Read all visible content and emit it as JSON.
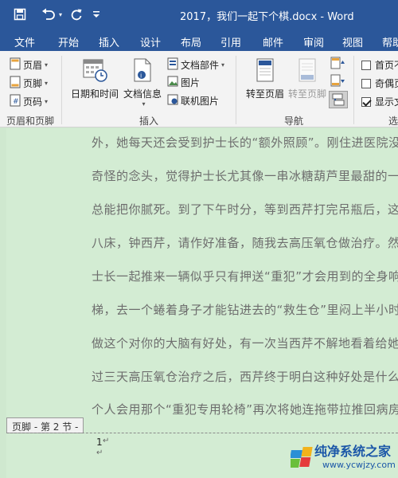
{
  "window": {
    "title": "2017，我们一起下个棋.docx - Word"
  },
  "quick_access": {
    "save_icon": "save-icon",
    "undo_icon": "undo-icon",
    "redo_icon": "redo-icon",
    "customize_icon": "customize-qat-icon"
  },
  "tabs": [
    {
      "label": "文件"
    },
    {
      "label": "开始"
    },
    {
      "label": "插入"
    },
    {
      "label": "设计"
    },
    {
      "label": "布局"
    },
    {
      "label": "引用"
    },
    {
      "label": "邮件"
    },
    {
      "label": "审阅"
    },
    {
      "label": "视图"
    },
    {
      "label": "帮助"
    }
  ],
  "ribbon": {
    "header_footer": {
      "header": "页眉",
      "footer": "页脚",
      "page_number": "页码",
      "group": "页眉和页脚"
    },
    "insert": {
      "date_time": "日期和时间",
      "doc_info": "文档信息",
      "doc_parts": "文档部件",
      "picture": "图片",
      "online_picture": "联机图片",
      "group": "插入"
    },
    "navigation": {
      "goto_header": "转至页眉",
      "goto_footer": "转至页脚",
      "group": "导航"
    },
    "options": {
      "first_page": "首页不",
      "odd_even": "奇偶页",
      "show_doc": "显示文",
      "group": "选"
    }
  },
  "document": {
    "lines": [
      "外，她每天还会受到护士长的“额外照顾”。刚住进医院没几",
      "奇怪的念头，觉得护士长尤其像一串冰糖葫芦里最甜的一颗",
      "总能把你腻死。到了下午时分，等到西芹打完吊瓶后，这颗糖",
      "八床，钟西芹，请作好准备，随我去高压氧仓做治疗。然后",
      "士长一起推来一辆似乎只有押送“重犯”才会用到的全身响个",
      "梯，去一个蜷着身子才能钻进去的“救生仓”里闷上半小时。",
      "做这个对你的大脑有好处，有一次当西芹不解地看着给她作",
      "过三天高压氧仓治疗之后，西芹终于明白这种好处是什么了",
      "个人会用那个“重犯专用轮椅”再次将她连拖带拉推回病房。"
    ],
    "footer_label": "页脚 - 第 2 节 -",
    "page_number": "1",
    "para_mark": "↵"
  },
  "watermark": {
    "text": "纯净系统之家",
    "url": "www.ycwjzy.com"
  },
  "colors": {
    "titlebar": "#2b579a",
    "ribbon": "#f3f3f3",
    "page": "#d3ecd3",
    "text": "#6d6d6d"
  }
}
